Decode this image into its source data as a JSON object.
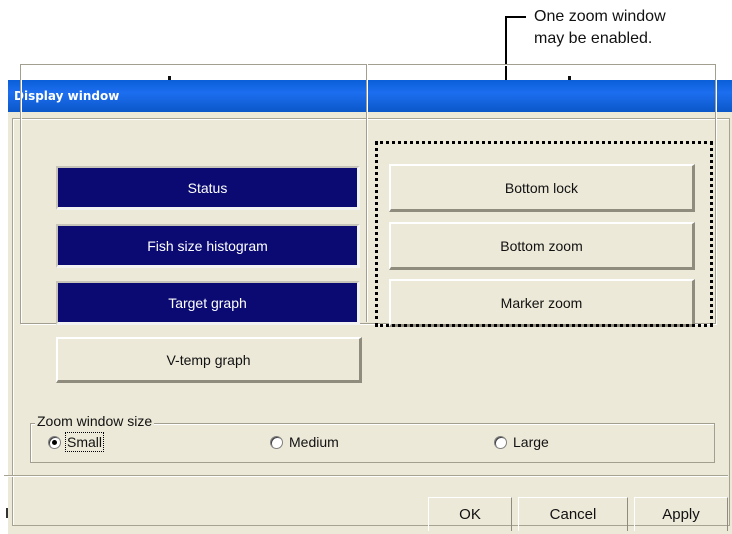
{
  "annotation": {
    "text": "One zoom window\nmay be enabled.",
    "line1": "One zoom window",
    "line2": "may be enabled."
  },
  "window": {
    "title": "Display window"
  },
  "left_buttons": [
    {
      "label": "Status",
      "state": "on"
    },
    {
      "label": "Fish size histogram",
      "state": "on"
    },
    {
      "label": "Target graph",
      "state": "on"
    },
    {
      "label": "V-temp graph",
      "state": "off"
    }
  ],
  "right_buttons": [
    {
      "label": "Bottom lock",
      "state": "off"
    },
    {
      "label": "Bottom zoom",
      "state": "off"
    },
    {
      "label": "Marker zoom",
      "state": "off"
    }
  ],
  "zoom_size": {
    "legend": "Zoom window size",
    "options": [
      "Small",
      "Medium",
      "Large"
    ],
    "selected": "Small"
  },
  "footer": {
    "ok": "OK",
    "cancel": "Cancel",
    "apply": "Apply"
  },
  "colors": {
    "selected_button": "#0a0a72",
    "dialog_face": "#ece9d8",
    "titlebar": "#0a5fd8"
  }
}
